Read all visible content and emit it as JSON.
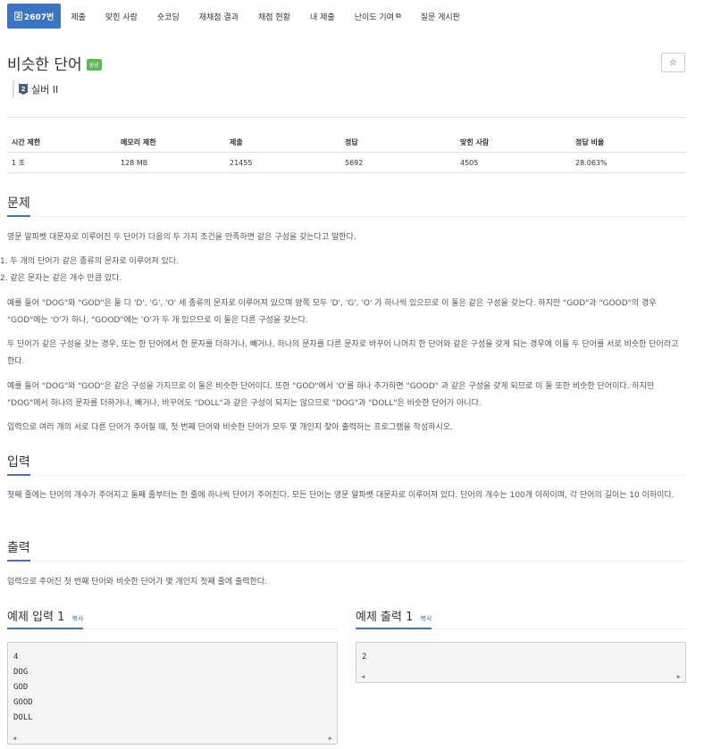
{
  "nav": {
    "tabs": [
      {
        "label": "2607번",
        "active": true
      },
      {
        "label": "제출"
      },
      {
        "label": "맞힌 사람"
      },
      {
        "label": "숏코딩"
      },
      {
        "label": "재채점 결과"
      },
      {
        "label": "채점 현황"
      },
      {
        "label": "내 제출"
      },
      {
        "label": "난이도 기여"
      },
      {
        "label": "질문 게시판"
      }
    ]
  },
  "problem": {
    "title": "비슷한 단어",
    "status_badge": "성공",
    "star": "☆",
    "tier_icon": "2",
    "tier": "실버 II"
  },
  "info": {
    "headers": [
      "시간 제한",
      "메모리 제한",
      "제출",
      "정답",
      "맞힌 사람",
      "정답 비율"
    ],
    "values": [
      "1 초",
      "128 MB",
      "21455",
      "5692",
      "4505",
      "28.063%"
    ]
  },
  "sections": {
    "description_title": "문제",
    "description": [
      "영문 알파벳 대문자로 이루어진 두 단어가 다음의 두 가지 조건을 만족하면 같은 구성을 갖는다고 말한다.",
      "두 개의 단어가 같은 종류의 문자로 이루어져 있다.",
      "같은 문자는 같은 개수 만큼 있다.",
      "예를 들어 \"DOG\"와 \"GOD\"은 둘 다 'D', 'G', 'O' 세 종류의 문자로 이루어져 있으며 양쪽 모두 'D', 'G', 'O' 가 하나씩 있으므로 이 둘은 같은 구성을 갖는다. 하지만 \"GOD\"과 \"GOOD\"의 경우 \"GOD\"에는 'O'가 하나, \"GOOD\"에는 'O'가 두 개 있으므로 이 둘은 다른 구성을 갖는다.",
      "두 단어가 같은 구성을 갖는 경우, 또는 한 단어에서 한 문자를 더하거나, 빼거나, 하나의 문자를 다른 문자로 바꾸어 나머지 한 단어와 같은 구성을 갖게 되는 경우에 이들 두 단어를 서로 비슷한 단어라고 한다.",
      "예를 들어 \"DOG\"와 \"GOD\"은 같은 구성을 가지므로 이 둘은 비슷한 단어이다. 또한 \"GOD\"에서 'O'를 하나 추가하면 \"GOOD\" 과 같은 구성을 갖게 되므로 이 둘 또한 비슷한 단어이다. 하지만 \"DOG\"에서 하나의 문자를 더하거나, 빼거나, 바꾸어도 \"DOLL\"과 같은 구성이 되지는 않으므로 \"DOG\"과 \"DOLL\"은 비슷한 단어가 아니다.",
      "입력으로 여러 개의 서로 다른 단어가 주어질 때, 첫 번째 단어와 비슷한 단어가 모두 몇 개인지 찾아 출력하는 프로그램을 작성하시오."
    ],
    "list_markers": [
      "1.",
      "2."
    ],
    "input_title": "입력",
    "input": "첫째 줄에는 단어의 개수가 주어지고 둘째 줄부터는 한 줄에 하나씩 단어가 주어진다. 모든 단어는 영문 알파벳 대문자로 이루어져 있다. 단어의 개수는 100개 이하이며, 각 단어의 길이는 10 이하이다.",
    "output_title": "출력",
    "output": "입력으로 주어진 첫 번째 단어와 비슷한 단어가 몇 개인지 첫째 줄에 출력한다."
  },
  "samples": {
    "input_title": "예제 입력 1",
    "output_title": "예제 출력 1",
    "copy_label": "복사",
    "input_lines": [
      "4",
      "DOG",
      "GOD",
      "GOOD",
      "DOLL"
    ],
    "output_lines": [
      "2"
    ]
  }
}
